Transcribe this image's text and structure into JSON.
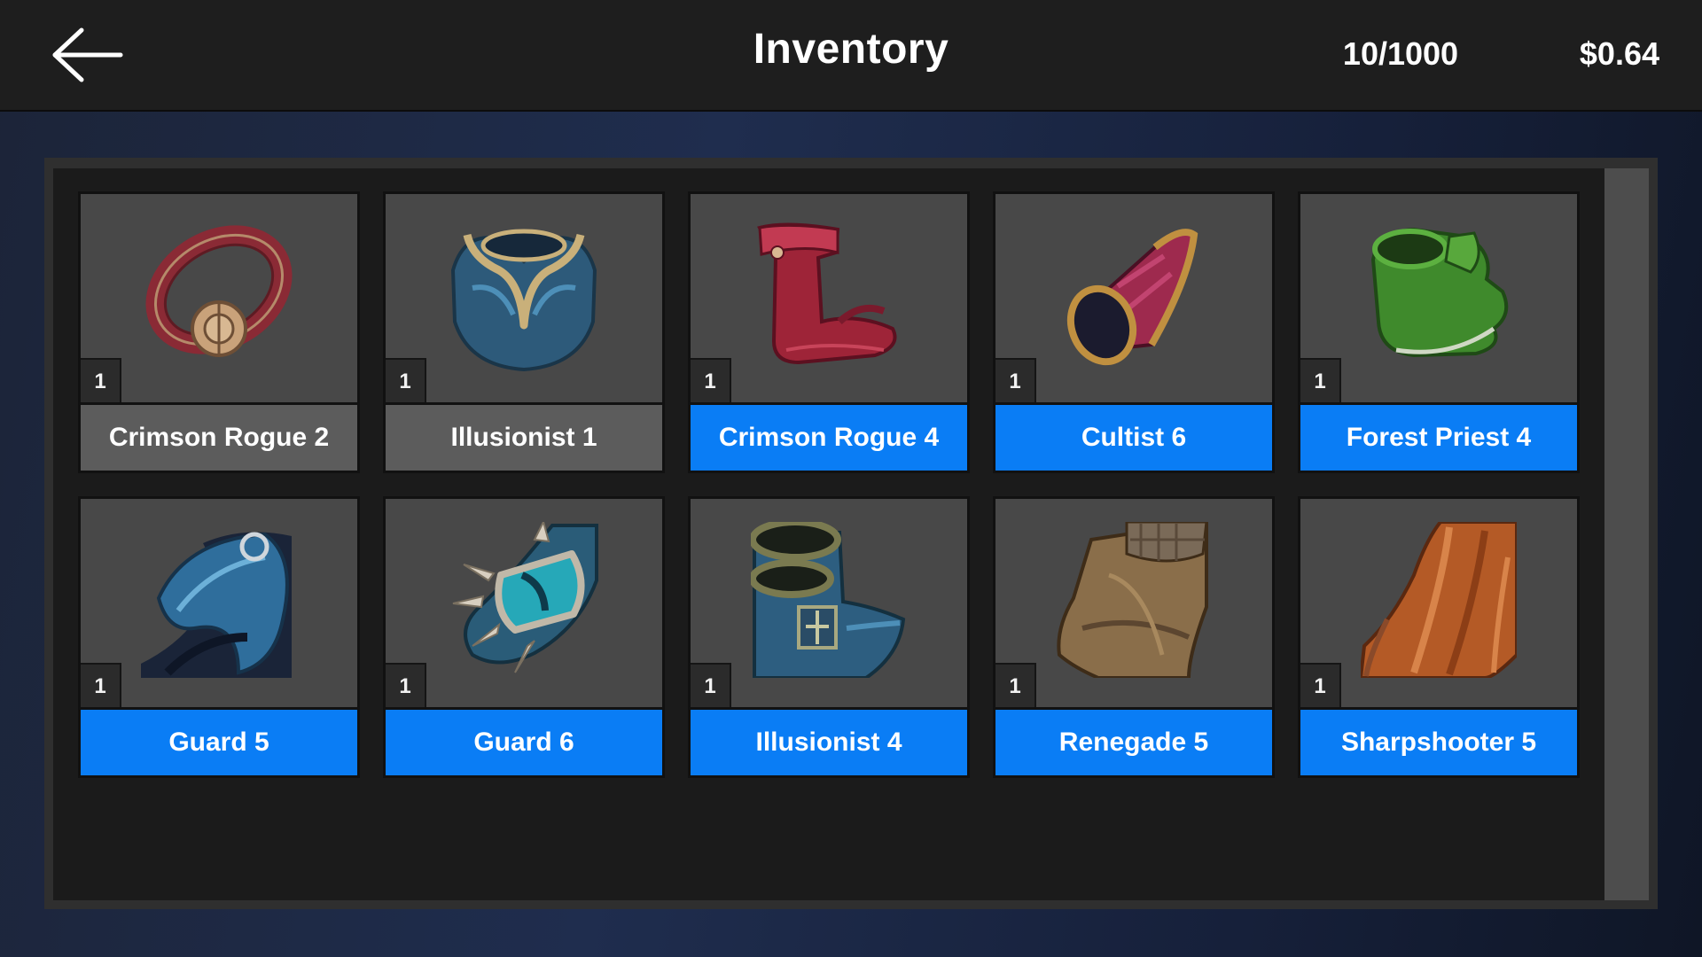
{
  "header": {
    "back_icon": "arrow-left-icon",
    "title": "Inventory",
    "capacity": "10/1000",
    "balance": "$0.64"
  },
  "colors": {
    "accent": "#0a7df5",
    "label_grey": "#5c5c5c",
    "header_bg": "#1e1e1e"
  },
  "items": [
    {
      "name": "Crimson Rogue 2",
      "quantity": "1",
      "icon": "crimson-bracelet-icon",
      "highlighted": false
    },
    {
      "name": "Illusionist 1",
      "quantity": "1",
      "icon": "blue-chest-armor-icon",
      "highlighted": false
    },
    {
      "name": "Crimson Rogue 4",
      "quantity": "1",
      "icon": "crimson-boots-icon",
      "highlighted": true
    },
    {
      "name": "Cultist 6",
      "quantity": "1",
      "icon": "crimson-bracer-icon",
      "highlighted": true
    },
    {
      "name": "Forest Priest 4",
      "quantity": "1",
      "icon": "green-boots-icon",
      "highlighted": true
    },
    {
      "name": "Guard 5",
      "quantity": "1",
      "icon": "blue-cape-icon",
      "highlighted": true
    },
    {
      "name": "Guard 6",
      "quantity": "1",
      "icon": "spiked-gauntlet-icon",
      "highlighted": true
    },
    {
      "name": "Illusionist 4",
      "quantity": "1",
      "icon": "blue-boots-icon",
      "highlighted": true
    },
    {
      "name": "Renegade 5",
      "quantity": "1",
      "icon": "leather-cloak-icon",
      "highlighted": true
    },
    {
      "name": "Sharpshooter 5",
      "quantity": "1",
      "icon": "orange-cape-icon",
      "highlighted": true
    }
  ]
}
